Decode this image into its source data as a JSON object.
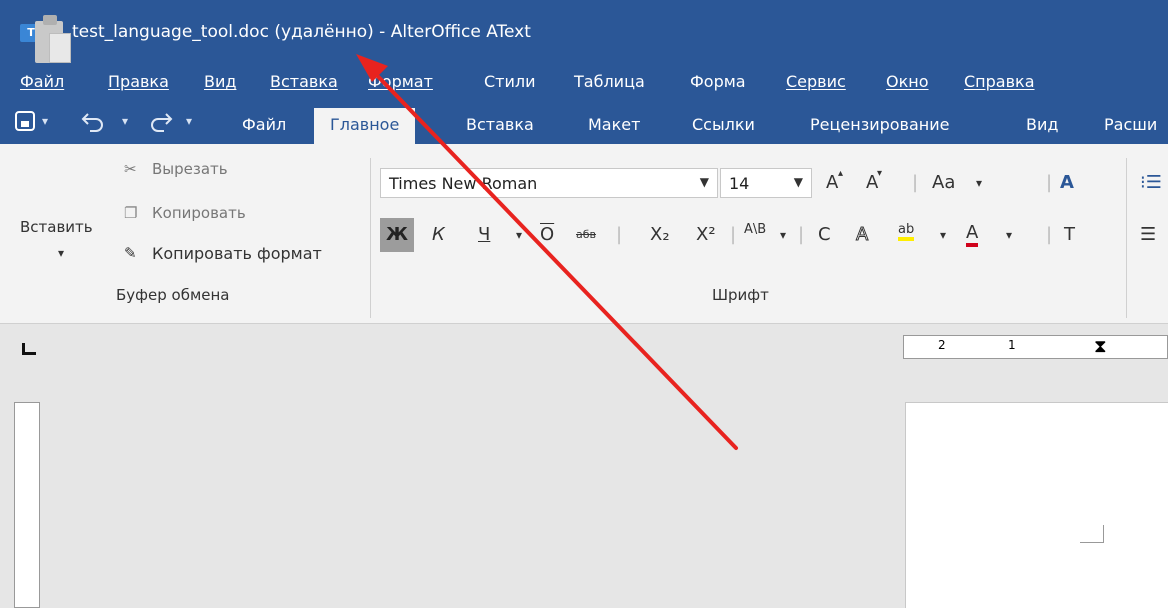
{
  "window": {
    "title": "test_language_tool.doc (удалённо) - AlterOffice AText",
    "app_icon_letter": "T"
  },
  "menubar": {
    "items": [
      "Файл",
      "Правка",
      "Вид",
      "Вставка",
      "Формат",
      "Стили",
      "Таблица",
      "Форма",
      "Сервис",
      "Окно",
      "Справка"
    ]
  },
  "quick_access": {
    "save_icon": "save-icon",
    "undo_icon": "undo-icon",
    "redo_icon": "redo-icon"
  },
  "tabs": {
    "items": [
      "Файл",
      "Главное",
      "Вставка",
      "Макет",
      "Ссылки",
      "Рецензирование",
      "Вид",
      "Расши"
    ],
    "active": "Главное"
  },
  "clipboard": {
    "paste_label": "Вставить",
    "cut_label": "Вырезать",
    "copy_label": "Копировать",
    "format_painter_label": "Копировать формат",
    "group_label": "Буфер обмена"
  },
  "font": {
    "family": "Times New Roman",
    "size": "14",
    "group_label": "Шрифт",
    "grow_label": "A",
    "shrink_label": "A",
    "case_label": "Aa",
    "bold_label": "Ж",
    "italic_label": "К",
    "underline_label": "Ч",
    "overline_label": "О",
    "strike_label": "абв",
    "subscript_label": "X₂",
    "superscript_label": "X²",
    "spacing_label": "A\\B",
    "shadow_label": "C",
    "outline_label": "A",
    "highlight_label": "ab",
    "color_label": "A"
  },
  "colors": {
    "titlebar": "#2b5797",
    "highlight_yellow": "#ffee00",
    "font_red": "#d0021b",
    "annotation_arrow": "#e8231f"
  },
  "ruler": {
    "h_ticks": [
      "2",
      "1"
    ]
  }
}
